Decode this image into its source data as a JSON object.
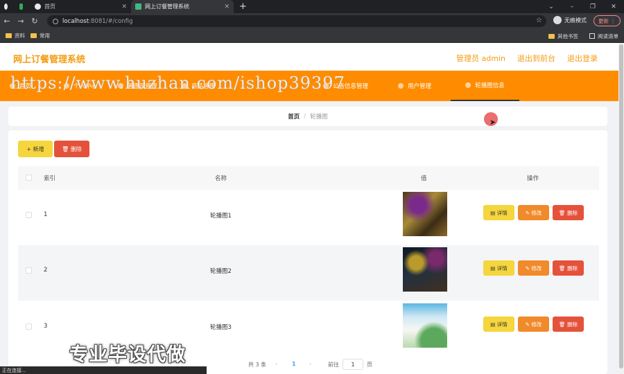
{
  "browser": {
    "tabs": [
      {
        "label": "",
        "icon": "github-icon"
      },
      {
        "label": "",
        "icon": "app-icon"
      },
      {
        "label": "首页",
        "icon": "globe-icon"
      },
      {
        "label": "网上订餐管理系统",
        "icon": "vue-icon",
        "active": true
      }
    ],
    "new_tab": "+",
    "url_host": "localhost",
    "url_path": ":8081/#/config",
    "incognito_label": "无痕模式",
    "update_label": "更新",
    "bookmarks": [
      "资料",
      "常用"
    ],
    "bookmarks_right": [
      "其他书签",
      "阅读清单"
    ]
  },
  "header": {
    "title": "网上订餐管理系统",
    "links": [
      "管理员 admin",
      "退出到前台",
      "退出登录"
    ]
  },
  "menu": {
    "items": [
      {
        "label": "首页"
      },
      {
        "label": "个人中心"
      },
      {
        "label": "管理员管理"
      },
      {
        "label": "商品管理"
      },
      {
        "label": "公告信息管理"
      },
      {
        "label": "用户管理"
      },
      {
        "label": "轮播图信息",
        "active": true
      }
    ]
  },
  "watermark": "https://www.huzhan.com/ishop39397",
  "breadcrumb": {
    "home": "首页",
    "separator": "/",
    "current": "轮播图"
  },
  "toolbar": {
    "add_label": "+ 新增",
    "delete_label": "删除"
  },
  "table": {
    "headers": {
      "index": "索引",
      "name": "名称",
      "value": "值",
      "actions": "操作"
    },
    "rows": [
      {
        "index": "1",
        "name": "轮播图1",
        "image": "carousel-thumbnail-1"
      },
      {
        "index": "2",
        "name": "轮播图2",
        "image": "carousel-thumbnail-2"
      },
      {
        "index": "3",
        "name": "轮播图3",
        "image": "carousel-thumbnail-3"
      }
    ],
    "row_actions": {
      "detail": "详情",
      "edit": "修改",
      "delete": "删除"
    }
  },
  "pagination": {
    "total": "共 3 条",
    "prev": "‹",
    "current_page": "1",
    "next": "›",
    "goto_label": "前往",
    "goto_value": "1",
    "page_suffix": "页"
  },
  "promo_text": "专业毕设代做",
  "status_text": "正在连接...",
  "colors": {
    "primary": "#ff8c00",
    "accent_text": "#f39c12",
    "yellow": "#f5d63d",
    "red": "#e5523b",
    "orange": "#f08a2a"
  }
}
